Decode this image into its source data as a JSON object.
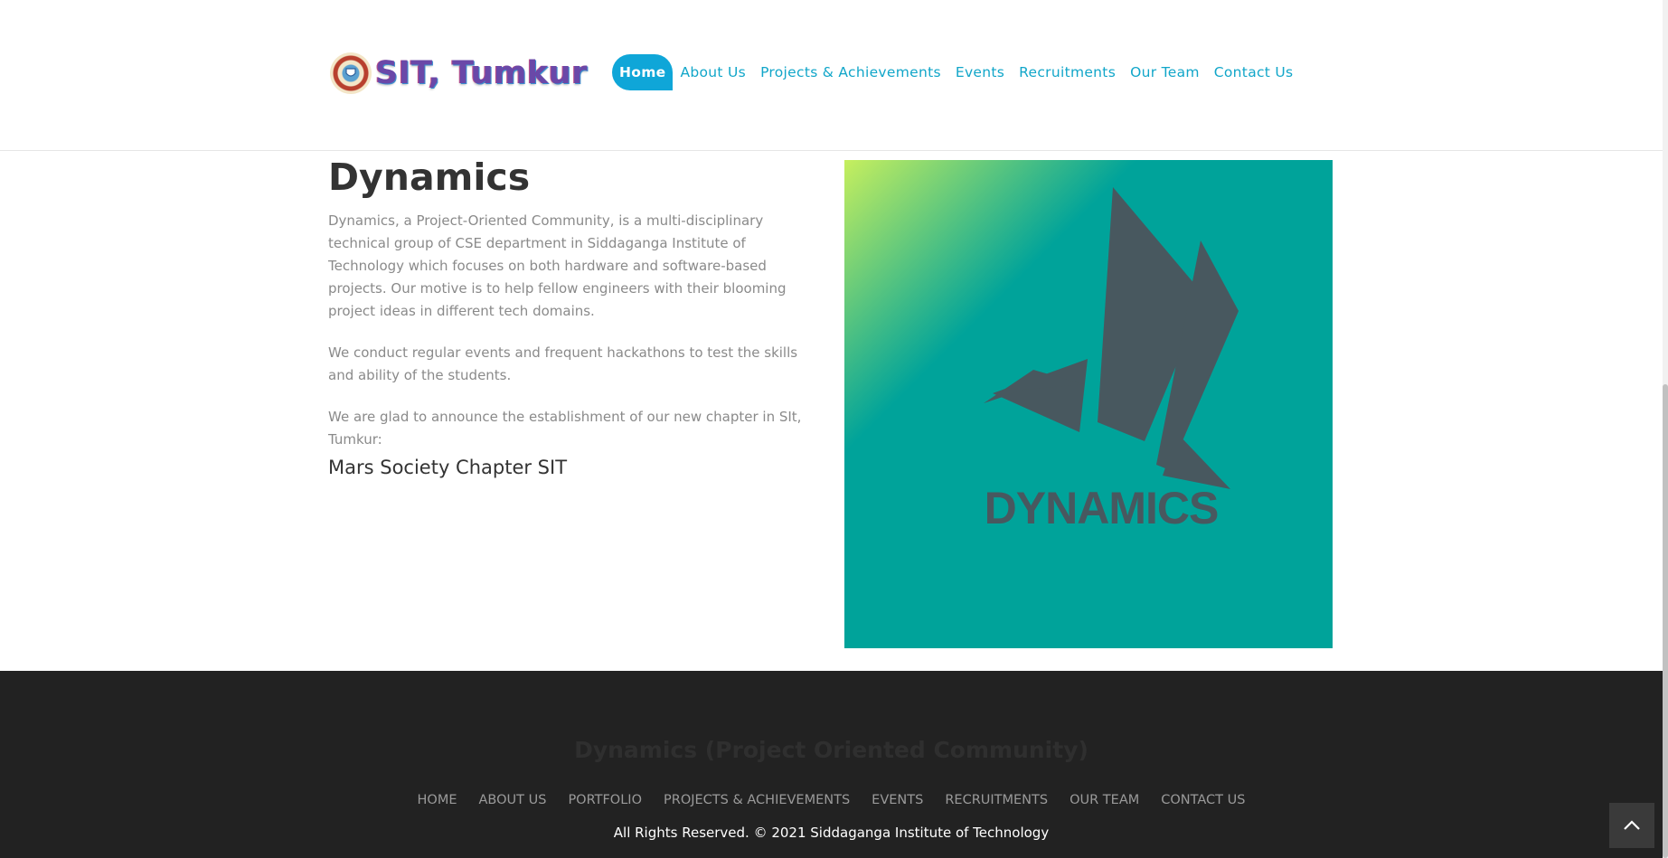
{
  "header": {
    "logo_text": "SIT, Tumkur",
    "nav": [
      {
        "label": "Home",
        "active": true
      },
      {
        "label": "About Us"
      },
      {
        "label": "Projects & Achievements"
      },
      {
        "label": "Events"
      },
      {
        "label": "Recruitments"
      },
      {
        "label": "Our Team"
      },
      {
        "label": "Contact Us"
      }
    ]
  },
  "main": {
    "title": "Dynamics",
    "paragraphs": [
      "Dynamics, a Project-Oriented Community, is a multi-disciplinary technical group of CSE department in Siddaganga Institute of Technology which focuses on both hardware and software-based projects. Our motive is to help fellow engineers with their blooming project ideas in different tech domains.",
      "We conduct regular events and frequent hackathons to test the skills and ability of the students.",
      "We are glad to announce the establishment of our new chapter in SIt, Tumkur:"
    ],
    "chapter_link": "Mars Society Chapter SIT",
    "hero_word": "DYNAMICS"
  },
  "footer": {
    "title": "Dynamics (Project Oriented Community)",
    "links": [
      "HOME",
      "ABOUT US",
      "PORTFOLIO",
      "PROJECTS & ACHIEVEMENTS",
      "EVENTS",
      "RECRUITMENTS",
      "OUR TEAM",
      "CONTACT US"
    ],
    "copyright": "All Rights Reserved. © 2021 Siddaganga Institute of Technology"
  },
  "colors": {
    "accent": "#0fa6d8",
    "hero_teal": "#00a39a",
    "hero_lime": "#c6ef5e",
    "footer_bg": "#222222"
  },
  "icons": [
    "sit-seal-icon",
    "chevron-up-icon"
  ]
}
